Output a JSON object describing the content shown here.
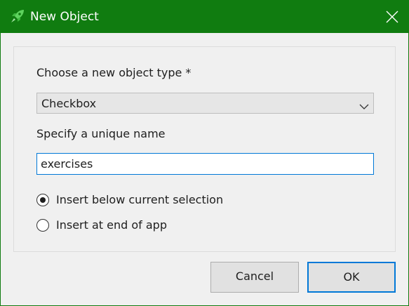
{
  "window": {
    "title": "New Object"
  },
  "form": {
    "type_label": "Choose a new object type *",
    "type_selected": "Checkbox",
    "name_label": "Specify a unique name",
    "name_value": "exercises",
    "radio_options": [
      {
        "label": "Insert below current selection",
        "checked": true
      },
      {
        "label": "Insert at end of app",
        "checked": false
      }
    ]
  },
  "buttons": {
    "cancel_label": "Cancel",
    "ok_label": "OK"
  },
  "colors": {
    "titlebar": "#107c10",
    "accent": "#0078d7",
    "background": "#f0f0f0"
  },
  "icons": {
    "app": "rocket-icon",
    "close": "close-icon",
    "dropdown": "chevron-down-icon"
  }
}
